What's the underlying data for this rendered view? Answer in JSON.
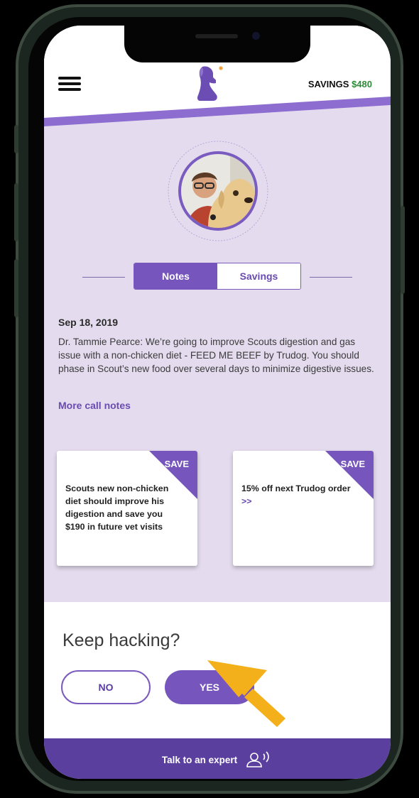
{
  "header": {
    "savings_label": "SAVINGS",
    "savings_amount": "$480"
  },
  "tabs": [
    {
      "label": "Notes",
      "active": true
    },
    {
      "label": "Savings",
      "active": false
    }
  ],
  "note": {
    "date": "Sep 18, 2019",
    "text": "Dr. Tammie Pearce: We’re going to improve Scouts digestion and gas issue with a  non-chicken diet - FEED ME BEEF by Trudog. You should phase in Scout’s new food over several days to minimize digestive issues.",
    "more_link": "More call notes"
  },
  "cards": [
    {
      "badge": "SAVE",
      "text": "Scouts new non-chicken diet should improve his digestion  and save you $190 in future vet visits",
      "link": ""
    },
    {
      "badge": "SAVE",
      "text": "15% off next Trudog order ",
      "link": ">>"
    }
  ],
  "prompt": {
    "title": "Keep hacking?",
    "no_label": "NO",
    "yes_label": "YES"
  },
  "footer": {
    "label": "Talk to an expert",
    "icon": "person-speaking-icon"
  },
  "colors": {
    "purple": "#7655bd",
    "lavender_bg": "#e4dcee",
    "savings_green": "#2e8b3a",
    "arrow": "#f4b01a"
  }
}
